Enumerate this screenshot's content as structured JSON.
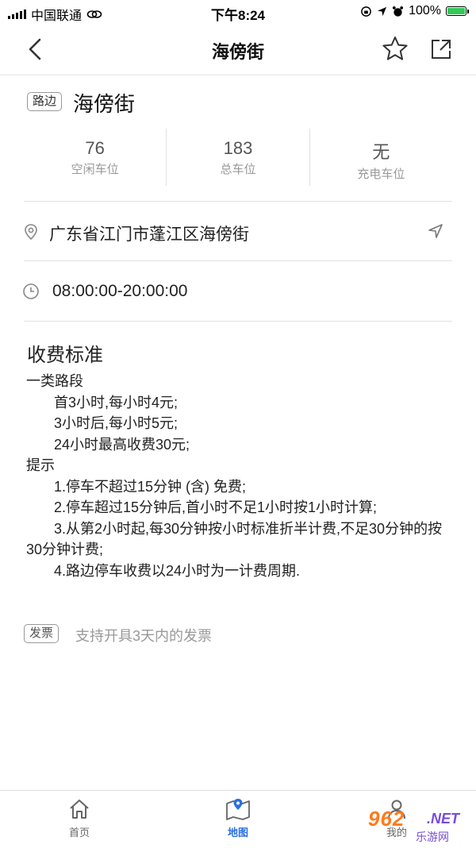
{
  "status_bar": {
    "carrier": "中国联通",
    "time": "下午8:24",
    "battery": "100%"
  },
  "nav": {
    "title": "海傍街"
  },
  "header": {
    "tag": "路边",
    "name": "海傍街"
  },
  "stats": [
    {
      "value": "76",
      "label": "空闲车位"
    },
    {
      "value": "183",
      "label": "总车位"
    },
    {
      "value": "无",
      "label": "充电车位"
    }
  ],
  "address": "广东省江门市蓬江区海傍街",
  "hours": "08:00:00-20:00:00",
  "fees": {
    "title": "收费标准",
    "section1": "一类路段",
    "rule1": "首3小时,每小时4元;",
    "rule2": "3小时后,每小时5元;",
    "rule3": "24小时最高收费30元;",
    "section2": "提示",
    "tip1": "1.停车不超过15分钟 (含) 免费;",
    "tip2": "2.停车超过15分钟后,首小时不足1小时按1小时计算;",
    "tip3": "3.从第2小时起,每30分钟按小时标准折半计费,不足30分钟的按30分钟计费;",
    "tip4": "4.路边停车收费以24小时为一计费周期."
  },
  "invoice": {
    "tag": "发票",
    "text": "支持开具3天内的发票"
  },
  "tabbar": {
    "home": "首页",
    "map": "地图",
    "mine": "我的"
  },
  "watermark": {
    "num": "962",
    "net": ".NET",
    "site": "乐游网"
  },
  "colors": {
    "accent": "#2a6fe0",
    "tab_inactive": "#666666",
    "watermark_orange": "#ff7a1a",
    "watermark_purple": "#7a4cd9"
  }
}
